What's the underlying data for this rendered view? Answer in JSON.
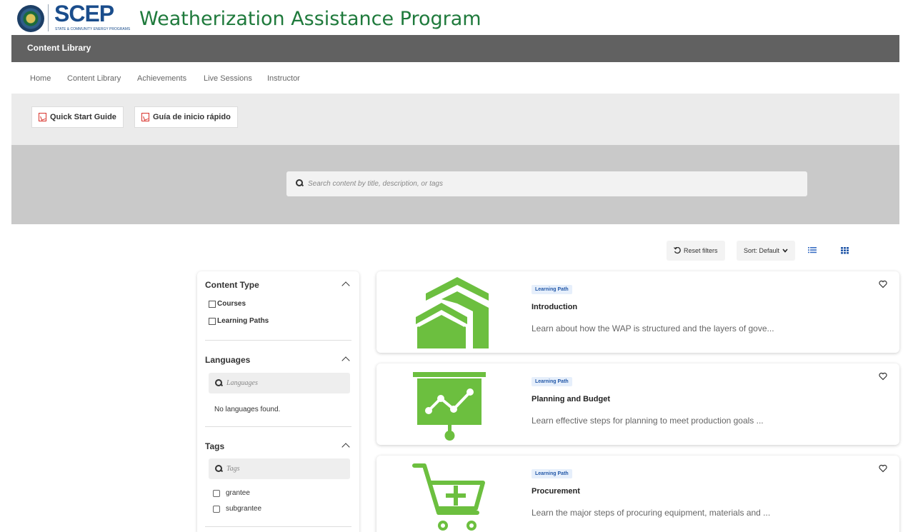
{
  "header": {
    "logo_text": "SCEP",
    "logo_subtext": "STATE & COMMUNITY ENERGY PROGRAMS",
    "app_title": "Weatherization Assistance Program",
    "page_title": "Content Library"
  },
  "nav": {
    "items": [
      "Home",
      "Content Library",
      "Achievements",
      "Live Sessions",
      "Instructor"
    ]
  },
  "guides": {
    "quick_start": "Quick Start Guide",
    "guia": "Guía de inicio rápido"
  },
  "search": {
    "placeholder": "Search content by title, description, or tags"
  },
  "toolbar": {
    "reset_label": "Reset filters",
    "sort_label": "Sort: Default",
    "list_view_icon": "list-view-icon",
    "grid_view_icon": "grid-view-icon"
  },
  "filters": {
    "content_type": {
      "title": "Content Type",
      "options": [
        "Courses",
        "Learning Paths"
      ]
    },
    "languages": {
      "title": "Languages",
      "placeholder": "Languages",
      "empty_text": "No languages found."
    },
    "tags": {
      "title": "Tags",
      "placeholder": "Tags",
      "options": [
        "grantee",
        "subgrantee"
      ]
    }
  },
  "cards": [
    {
      "badge": "Learning Path",
      "title": "Introduction",
      "description": "Learn about how the WAP is structured and the layers of gove...",
      "icon": "houses-icon"
    },
    {
      "badge": "Learning Path",
      "title": "Planning and Budget",
      "description": "Learn effective steps for planning to meet production goals ...",
      "icon": "presentation-chart-icon"
    },
    {
      "badge": "Learning Path",
      "title": "Procurement",
      "description": "Learn the major steps of procuring equipment, materials and ...",
      "icon": "shopping-cart-icon"
    }
  ],
  "colors": {
    "brand_green": "#6cbf3f",
    "title_green": "#1f7a3c",
    "logo_blue": "#1a4d8c",
    "titlebar_gray": "#616161",
    "badge_blue": "#2358a8"
  }
}
